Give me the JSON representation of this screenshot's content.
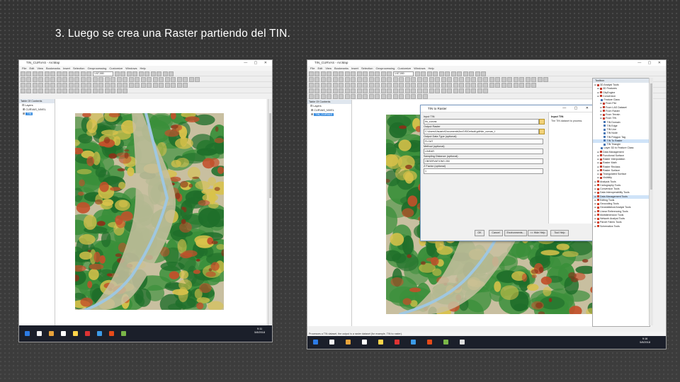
{
  "slide": {
    "title": "3. Luego se crea una Raster partiendo del TIN."
  },
  "left_window": {
    "title": "TIN_CURVAS - ArcMap",
    "window_controls": "— ▢ ✕",
    "menu": [
      "File",
      "Edit",
      "View",
      "Bookmarks",
      "Insert",
      "Selection",
      "Geoprocessing",
      "Customize",
      "Windows",
      "Help"
    ],
    "scale_value": "1:57,000",
    "toc": {
      "title": "Table Of Contents",
      "layers_label": "Layers",
      "items": [
        "CURVAS_NIVEL",
        "TIN"
      ],
      "selected": "TIN"
    },
    "status": "",
    "taskbar_time": "9:11",
    "taskbar_date": "5/8/2018"
  },
  "right_window": {
    "title": "TIN_CURVAS - ArcMap",
    "window_controls": "— ▢ ✕",
    "menu": [
      "File",
      "Edit",
      "View",
      "Bookmarks",
      "Insert",
      "Selection",
      "Geoprocessing",
      "Customize",
      "Windows",
      "Help"
    ],
    "scale_value": "1:57,000",
    "toc": {
      "title": "Table Of Contents",
      "layers_label": "Layers",
      "items": [
        "CURVAS_NIVEL",
        "TIN_CURVAS"
      ],
      "selected": "TIN_CURVAS"
    },
    "status": "Processes a TIN dataset, the output is a raster dataset (for example, TIN to raster).",
    "taskbar_time": "9:16",
    "taskbar_date": "5/8/2018"
  },
  "dialog": {
    "title": "TIN to Raster",
    "window_controls": "— ▢ ✕",
    "fields": [
      {
        "label": "Input TIN",
        "value": "tin_curvas"
      },
      {
        "label": "Output Raster",
        "value": "C:\\Users\\Usuario\\Documents\\ArcGIS\\Default.gdb\\tin_curvas_t"
      },
      {
        "label": "Output Data Type (optional)",
        "value": "FLOAT"
      },
      {
        "label": "Method (optional)",
        "value": "LINEAR"
      },
      {
        "label": "Sampling Distance (optional)",
        "value": "OBSERVATIONS 250"
      },
      {
        "label": "Z Factor (optional)",
        "value": "1"
      }
    ],
    "buttons": [
      "OK",
      "Cancel",
      "Environments...",
      "<< Hide Help",
      "Tool Help"
    ],
    "help_title": "Input TIN",
    "help_text": "The TIN dataset to process."
  },
  "toolbox": {
    "title": "Toolbox",
    "items": [
      {
        "label": "3D Analyst Tools",
        "indent": 0,
        "type": "box"
      },
      {
        "label": "3D Features",
        "indent": 1,
        "type": "box"
      },
      {
        "label": "CityEngine",
        "indent": 1,
        "type": "box"
      },
      {
        "label": "Conversion",
        "indent": 1,
        "type": "box"
      },
      {
        "label": "Feature Class",
        "indent": 2,
        "type": "tool"
      },
      {
        "label": "From File",
        "indent": 2,
        "type": "box"
      },
      {
        "label": "From LAS Dataset",
        "indent": 2,
        "type": "box"
      },
      {
        "label": "From Raster",
        "indent": 2,
        "type": "box"
      },
      {
        "label": "From Terrain",
        "indent": 2,
        "type": "box"
      },
      {
        "label": "From TIN",
        "indent": 2,
        "type": "box"
      },
      {
        "label": "TIN Domain",
        "indent": 3,
        "type": "tool"
      },
      {
        "label": "TIN Edge",
        "indent": 3,
        "type": "tool"
      },
      {
        "label": "TIN Line",
        "indent": 3,
        "type": "tool"
      },
      {
        "label": "TIN Node",
        "indent": 3,
        "type": "tool"
      },
      {
        "label": "TIN Polygon Tag",
        "indent": 3,
        "type": "tool"
      },
      {
        "label": "TIN To Raster",
        "indent": 3,
        "type": "tool",
        "highlight": true
      },
      {
        "label": "TIN Triangle",
        "indent": 3,
        "type": "tool"
      },
      {
        "label": "Layer 3D to Feature Class",
        "indent": 2,
        "type": "tool"
      },
      {
        "label": "Data Management",
        "indent": 1,
        "type": "box"
      },
      {
        "label": "Functional Surface",
        "indent": 1,
        "type": "box"
      },
      {
        "label": "Raster Interpolation",
        "indent": 1,
        "type": "box"
      },
      {
        "label": "Raster Math",
        "indent": 1,
        "type": "box"
      },
      {
        "label": "Raster Reclass",
        "indent": 1,
        "type": "box"
      },
      {
        "label": "Raster Surface",
        "indent": 1,
        "type": "box"
      },
      {
        "label": "Triangulated Surface",
        "indent": 1,
        "type": "box"
      },
      {
        "label": "Visibility",
        "indent": 1,
        "type": "box"
      },
      {
        "label": "Analysis Tools",
        "indent": 0,
        "type": "red"
      },
      {
        "label": "Cartography Tools",
        "indent": 0,
        "type": "red"
      },
      {
        "label": "Conversion Tools",
        "indent": 0,
        "type": "red"
      },
      {
        "label": "Data Interoperability Tools",
        "indent": 0,
        "type": "red"
      },
      {
        "label": "Data Management Tools",
        "indent": 0,
        "type": "red",
        "highlight": true
      },
      {
        "label": "Editing Tools",
        "indent": 0,
        "type": "red"
      },
      {
        "label": "Geocoding Tools",
        "indent": 0,
        "type": "red"
      },
      {
        "label": "Geostatistical Analyst Tools",
        "indent": 0,
        "type": "red"
      },
      {
        "label": "Linear Referencing Tools",
        "indent": 0,
        "type": "red"
      },
      {
        "label": "Multidimension Tools",
        "indent": 0,
        "type": "red"
      },
      {
        "label": "Network Analyst Tools",
        "indent": 0,
        "type": "red"
      },
      {
        "label": "Parcel Fabric Tools",
        "indent": 0,
        "type": "red"
      },
      {
        "label": "Schematics Tools",
        "indent": 0,
        "type": "red"
      }
    ]
  },
  "colors": {
    "slide_bg": "#3a3a3a",
    "selection_blue": "#3d8fe0",
    "taskbar": "#1b1f2a",
    "terrain": [
      "#c8bfa0",
      "#3a8f3a",
      "#1f6e2a",
      "#d9c24a",
      "#c2502a",
      "#8a3018",
      "#9fc7e0"
    ]
  }
}
